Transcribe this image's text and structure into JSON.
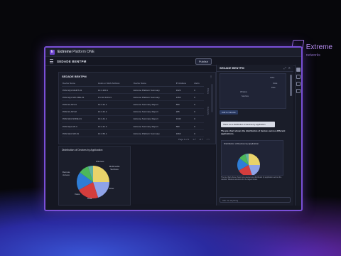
{
  "brand": {
    "name": "Extreme",
    "sub": "networks"
  },
  "app": {
    "logo": "E",
    "title_bold": "Extreme",
    "title_rest": " Platform ONE"
  },
  "toolbar": {
    "page_title": "SEDADE BENTPM",
    "publish_label": "Publish"
  },
  "table_card": {
    "title": "SEDADE BENTPM",
    "columns": [
      "Device Name",
      "Hosts on Web Address",
      "Device Name",
      "IP Address",
      "Alerts"
    ],
    "rows": [
      [
        "PAN-SQ1-MGMT-01",
        "10.1.200.1",
        "Extreme Platform Summary",
        "1920",
        "0"
      ],
      [
        "PAN-SQ1-SW-CRE-01",
        "172.16.100.21",
        "Extreme Platform Summary",
        "1350",
        "0"
      ],
      [
        "PAN-S1-AP-01",
        "10.1.31.1",
        "Extreme Summary Report",
        "550",
        "0"
      ],
      [
        "PAN-S1-AP-02",
        "10.1.31.2",
        "Extreme Summary Report",
        "205",
        "0"
      ],
      [
        "PAN-SQ1-NODE-01",
        "10.1.41.1",
        "Extreme Summary Report",
        "1340",
        "0"
      ],
      [
        "PAN-SQ1-AP-3",
        "10.1.41.3",
        "Extreme Summary Report",
        "580",
        "0"
      ],
      [
        "PAN-SQ1-SW-01",
        "10.1.50.1",
        "Extreme Platform Summary",
        "1960",
        "0"
      ]
    ],
    "pager": [
      "Page 1 of 1",
      "1-7",
      "of 7",
      "< >"
    ],
    "side_tabs": [
      "Filters",
      "Columns"
    ]
  },
  "pie_card": {
    "title": "Distribution of Devices by Application",
    "labels": [
      "Wireless",
      "Multimedia Services",
      "Remote Access",
      "Other",
      "Voice",
      "Data"
    ]
  },
  "chart_data": {
    "type": "pie",
    "title": "Distribution of Devices by Application",
    "categories": [
      "Wireless",
      "Multimedia Services",
      "Remote Access",
      "Other",
      "Voice",
      "Data"
    ],
    "values": [
      25,
      20,
      22,
      18,
      10,
      5
    ],
    "colors": [
      "#e9d36a",
      "#8fa3e8",
      "#d43d3d",
      "#2e7dd6",
      "#4cb85a",
      "#5fb0a0"
    ]
  },
  "right_panel": {
    "title": "SEDADE BENTPM",
    "mini_labels": [
      "Other",
      "Voice",
      "Data",
      "Wireless",
      "Services"
    ],
    "chip": "Add to Canvas",
    "question": "Show me a distribution of devices by application",
    "answer": "The pie chart shows the distribution of devices across different applications.",
    "resp_title": "Distribution of Devices by Application",
    "resp_text": "The pie chart above shows how devices are distributed by application across the network. Wireless accounts for the largest share.",
    "input_placeholder": "Ask me anything"
  }
}
